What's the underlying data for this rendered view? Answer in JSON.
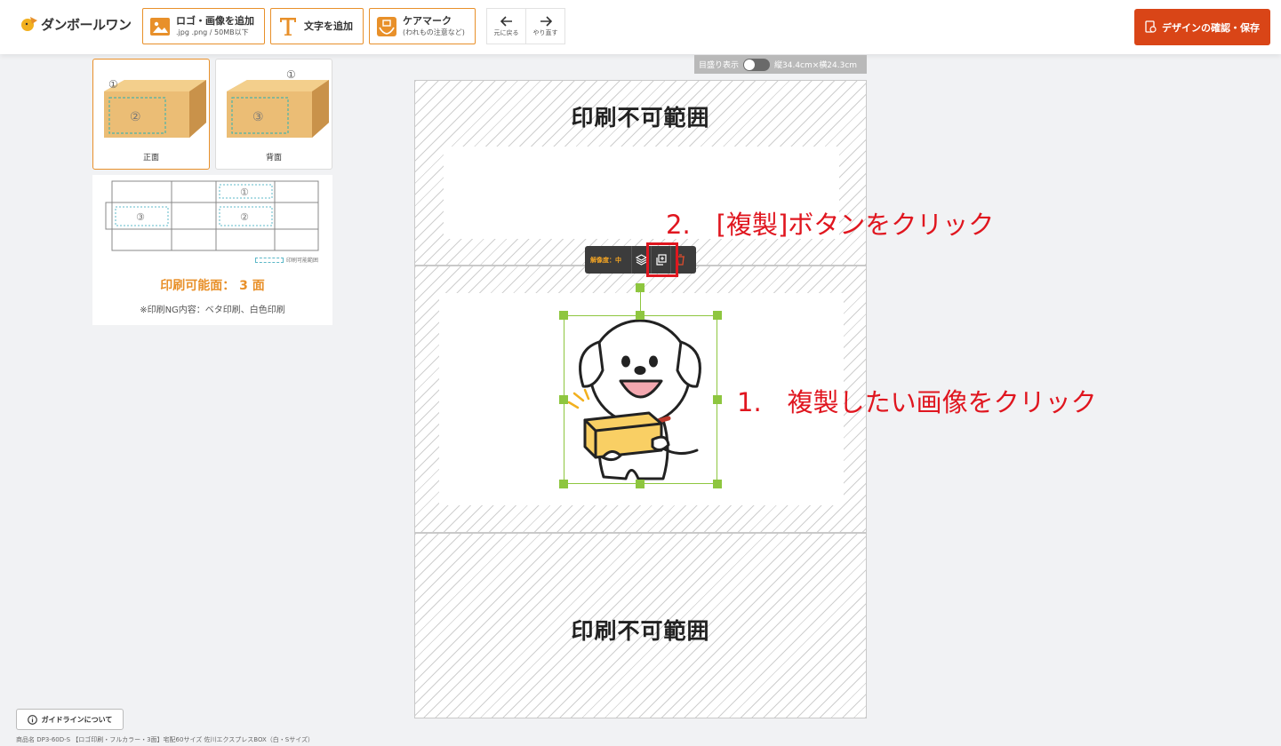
{
  "header": {
    "logo_text": "ダンボールワン",
    "add_image": {
      "label": "ロゴ・画像を追加",
      "sub": ".jpg .png / 50MB以下"
    },
    "add_text": {
      "label": "文字を追加"
    },
    "care_mark": {
      "label": "ケアマーク",
      "sub": "(われもの注意など)"
    },
    "undo_label": "元に戻る",
    "redo_label": "やり直す",
    "save_label": "デザインの確認・保存"
  },
  "left_panel": {
    "faces": [
      {
        "label": "正面",
        "active": true
      },
      {
        "label": "背面",
        "active": false
      }
    ],
    "net_legend": "印刷可能範囲",
    "net_title": "印刷可能面： 3 面",
    "net_note": "※印刷NG内容：ベタ印刷、白色印刷"
  },
  "canvas": {
    "ruler_label": "目盛り表示",
    "dimensions": "縦34.4cm×横24.3cm",
    "no_print_label": "印刷不可範囲",
    "toolbar": {
      "resolution": "解像度：中"
    }
  },
  "annotations": {
    "step1": "1.　複製したい画像をクリック",
    "step2": "2.　[複製]ボタンをクリック"
  },
  "footer": {
    "guide_label": "ガイドラインについて",
    "product_name": "商品名 DP3-60D-S 【ロゴ印刷・フルカラー・3面】宅配60サイズ 佐川エクスプレスBOX（白・Sサイズ）"
  },
  "colors": {
    "accent": "#e8902a",
    "primary": "#d94517",
    "selection": "#8ec63f",
    "annotation": "#e0161f"
  }
}
